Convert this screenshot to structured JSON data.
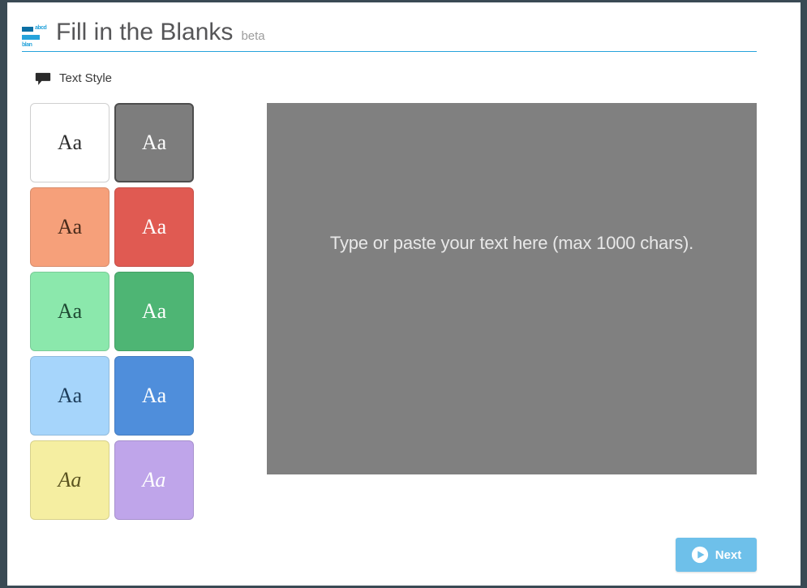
{
  "header": {
    "logo_abcd": "abcd",
    "logo_blan": "blan",
    "title": "Fill in the Blanks",
    "beta": "beta"
  },
  "section": {
    "label": "Text Style"
  },
  "swatches": {
    "sample_plain": "Aa",
    "sample_casual": "Aa",
    "sample_script": "Aa"
  },
  "textarea": {
    "placeholder": "Type or paste your text here (max 1000 chars).",
    "value": ""
  },
  "footer": {
    "next": "Next"
  },
  "colors": {
    "accent": "#26a3db",
    "button": "#6ec0ea"
  }
}
